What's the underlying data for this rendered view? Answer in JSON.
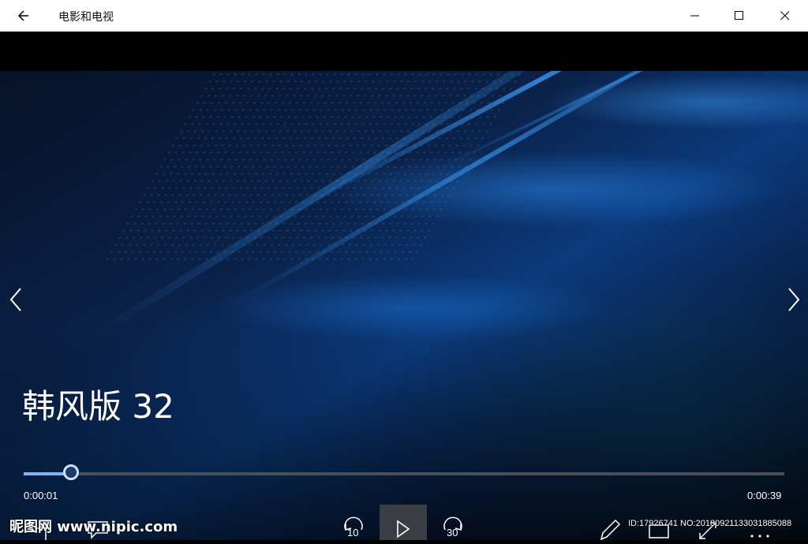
{
  "app": {
    "title": "电影和电视"
  },
  "titlebar": {
    "back_icon": "arrow-left-icon",
    "minimize_icon": "minimize-icon",
    "maximize_icon": "maximize-icon",
    "close_icon": "close-icon"
  },
  "player": {
    "video_title": "韩风版 32",
    "elapsed": "0:00:01",
    "total": "0:00:39",
    "progress_fraction": 0.062,
    "skip_back_label": "10",
    "skip_forward_label": "30",
    "accent_color": "#7fb2ff"
  },
  "watermark": {
    "left_text": "昵图网 www.nipic.com",
    "right_text": "ID:17926741 NO:20180921133031885088"
  }
}
